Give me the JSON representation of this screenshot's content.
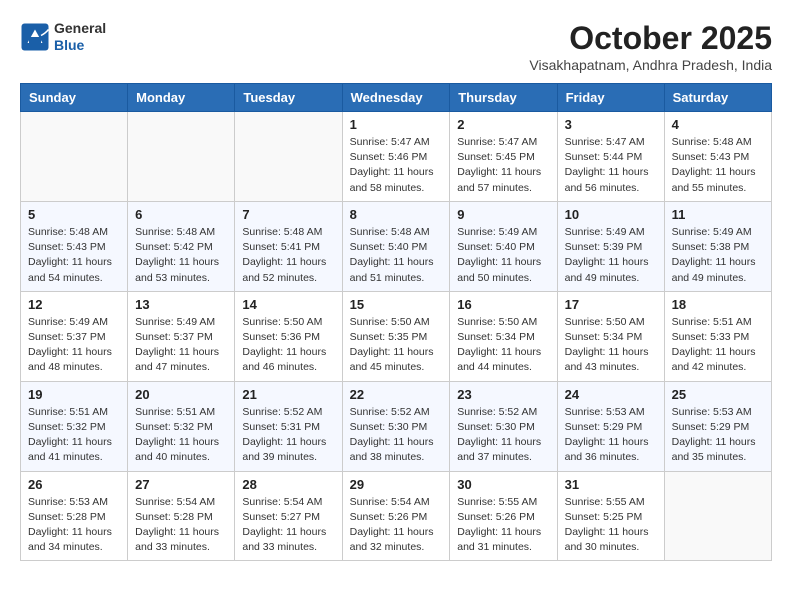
{
  "header": {
    "logo": {
      "general": "General",
      "blue": "Blue"
    },
    "title": "October 2025",
    "location": "Visakhapatnam, Andhra Pradesh, India"
  },
  "weekdays": [
    "Sunday",
    "Monday",
    "Tuesday",
    "Wednesday",
    "Thursday",
    "Friday",
    "Saturday"
  ],
  "weeks": [
    [
      {
        "day": "",
        "sunrise": "",
        "sunset": "",
        "daylight": ""
      },
      {
        "day": "",
        "sunrise": "",
        "sunset": "",
        "daylight": ""
      },
      {
        "day": "",
        "sunrise": "",
        "sunset": "",
        "daylight": ""
      },
      {
        "day": "1",
        "sunrise": "Sunrise: 5:47 AM",
        "sunset": "Sunset: 5:46 PM",
        "daylight": "Daylight: 11 hours and 58 minutes."
      },
      {
        "day": "2",
        "sunrise": "Sunrise: 5:47 AM",
        "sunset": "Sunset: 5:45 PM",
        "daylight": "Daylight: 11 hours and 57 minutes."
      },
      {
        "day": "3",
        "sunrise": "Sunrise: 5:47 AM",
        "sunset": "Sunset: 5:44 PM",
        "daylight": "Daylight: 11 hours and 56 minutes."
      },
      {
        "day": "4",
        "sunrise": "Sunrise: 5:48 AM",
        "sunset": "Sunset: 5:43 PM",
        "daylight": "Daylight: 11 hours and 55 minutes."
      }
    ],
    [
      {
        "day": "5",
        "sunrise": "Sunrise: 5:48 AM",
        "sunset": "Sunset: 5:43 PM",
        "daylight": "Daylight: 11 hours and 54 minutes."
      },
      {
        "day": "6",
        "sunrise": "Sunrise: 5:48 AM",
        "sunset": "Sunset: 5:42 PM",
        "daylight": "Daylight: 11 hours and 53 minutes."
      },
      {
        "day": "7",
        "sunrise": "Sunrise: 5:48 AM",
        "sunset": "Sunset: 5:41 PM",
        "daylight": "Daylight: 11 hours and 52 minutes."
      },
      {
        "day": "8",
        "sunrise": "Sunrise: 5:48 AM",
        "sunset": "Sunset: 5:40 PM",
        "daylight": "Daylight: 11 hours and 51 minutes."
      },
      {
        "day": "9",
        "sunrise": "Sunrise: 5:49 AM",
        "sunset": "Sunset: 5:40 PM",
        "daylight": "Daylight: 11 hours and 50 minutes."
      },
      {
        "day": "10",
        "sunrise": "Sunrise: 5:49 AM",
        "sunset": "Sunset: 5:39 PM",
        "daylight": "Daylight: 11 hours and 49 minutes."
      },
      {
        "day": "11",
        "sunrise": "Sunrise: 5:49 AM",
        "sunset": "Sunset: 5:38 PM",
        "daylight": "Daylight: 11 hours and 49 minutes."
      }
    ],
    [
      {
        "day": "12",
        "sunrise": "Sunrise: 5:49 AM",
        "sunset": "Sunset: 5:37 PM",
        "daylight": "Daylight: 11 hours and 48 minutes."
      },
      {
        "day": "13",
        "sunrise": "Sunrise: 5:49 AM",
        "sunset": "Sunset: 5:37 PM",
        "daylight": "Daylight: 11 hours and 47 minutes."
      },
      {
        "day": "14",
        "sunrise": "Sunrise: 5:50 AM",
        "sunset": "Sunset: 5:36 PM",
        "daylight": "Daylight: 11 hours and 46 minutes."
      },
      {
        "day": "15",
        "sunrise": "Sunrise: 5:50 AM",
        "sunset": "Sunset: 5:35 PM",
        "daylight": "Daylight: 11 hours and 45 minutes."
      },
      {
        "day": "16",
        "sunrise": "Sunrise: 5:50 AM",
        "sunset": "Sunset: 5:34 PM",
        "daylight": "Daylight: 11 hours and 44 minutes."
      },
      {
        "day": "17",
        "sunrise": "Sunrise: 5:50 AM",
        "sunset": "Sunset: 5:34 PM",
        "daylight": "Daylight: 11 hours and 43 minutes."
      },
      {
        "day": "18",
        "sunrise": "Sunrise: 5:51 AM",
        "sunset": "Sunset: 5:33 PM",
        "daylight": "Daylight: 11 hours and 42 minutes."
      }
    ],
    [
      {
        "day": "19",
        "sunrise": "Sunrise: 5:51 AM",
        "sunset": "Sunset: 5:32 PM",
        "daylight": "Daylight: 11 hours and 41 minutes."
      },
      {
        "day": "20",
        "sunrise": "Sunrise: 5:51 AM",
        "sunset": "Sunset: 5:32 PM",
        "daylight": "Daylight: 11 hours and 40 minutes."
      },
      {
        "day": "21",
        "sunrise": "Sunrise: 5:52 AM",
        "sunset": "Sunset: 5:31 PM",
        "daylight": "Daylight: 11 hours and 39 minutes."
      },
      {
        "day": "22",
        "sunrise": "Sunrise: 5:52 AM",
        "sunset": "Sunset: 5:30 PM",
        "daylight": "Daylight: 11 hours and 38 minutes."
      },
      {
        "day": "23",
        "sunrise": "Sunrise: 5:52 AM",
        "sunset": "Sunset: 5:30 PM",
        "daylight": "Daylight: 11 hours and 37 minutes."
      },
      {
        "day": "24",
        "sunrise": "Sunrise: 5:53 AM",
        "sunset": "Sunset: 5:29 PM",
        "daylight": "Daylight: 11 hours and 36 minutes."
      },
      {
        "day": "25",
        "sunrise": "Sunrise: 5:53 AM",
        "sunset": "Sunset: 5:29 PM",
        "daylight": "Daylight: 11 hours and 35 minutes."
      }
    ],
    [
      {
        "day": "26",
        "sunrise": "Sunrise: 5:53 AM",
        "sunset": "Sunset: 5:28 PM",
        "daylight": "Daylight: 11 hours and 34 minutes."
      },
      {
        "day": "27",
        "sunrise": "Sunrise: 5:54 AM",
        "sunset": "Sunset: 5:28 PM",
        "daylight": "Daylight: 11 hours and 33 minutes."
      },
      {
        "day": "28",
        "sunrise": "Sunrise: 5:54 AM",
        "sunset": "Sunset: 5:27 PM",
        "daylight": "Daylight: 11 hours and 33 minutes."
      },
      {
        "day": "29",
        "sunrise": "Sunrise: 5:54 AM",
        "sunset": "Sunset: 5:26 PM",
        "daylight": "Daylight: 11 hours and 32 minutes."
      },
      {
        "day": "30",
        "sunrise": "Sunrise: 5:55 AM",
        "sunset": "Sunset: 5:26 PM",
        "daylight": "Daylight: 11 hours and 31 minutes."
      },
      {
        "day": "31",
        "sunrise": "Sunrise: 5:55 AM",
        "sunset": "Sunset: 5:25 PM",
        "daylight": "Daylight: 11 hours and 30 minutes."
      },
      {
        "day": "",
        "sunrise": "",
        "sunset": "",
        "daylight": ""
      }
    ]
  ]
}
